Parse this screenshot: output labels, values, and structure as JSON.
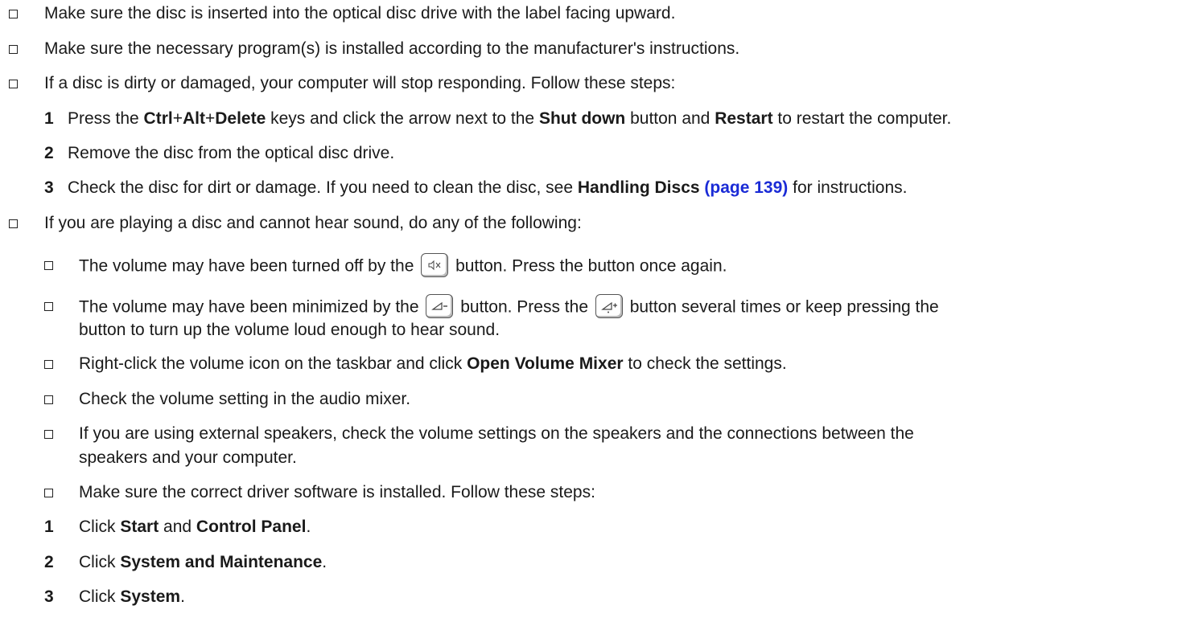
{
  "items": {
    "l1": "Make sure the disc is inserted into the optical disc drive with the label facing upward.",
    "l2": "Make sure the necessary program(s) is installed according to the manufacturer's instructions.",
    "l3": "If a disc is dirty or damaged, your computer will stop responding. Follow these steps:",
    "s1": {
      "num": "1",
      "t1": "Press the ",
      "k1": "Ctrl",
      "plus1": "+",
      "k2": "Alt",
      "plus2": "+",
      "k3": "Delete",
      "t2": " keys and click the arrow next to the ",
      "k4": "Shut down",
      "t3": " button and ",
      "k5": "Restart",
      "t4": " to restart the computer."
    },
    "s2": {
      "num": "2",
      "text": "Remove the disc from the optical disc drive."
    },
    "s3": {
      "num": "3",
      "t1": "Check the disc for dirt or damage. If you need to clean the disc, see ",
      "bold": "Handling Discs",
      "link": "(page 139)",
      "t2": " for instructions."
    },
    "l4": "If you are playing a disc and cannot hear sound, do any of the following:",
    "sub1": {
      "t1": "The volume may have been turned off by the",
      "t2": "button. Press the button once again."
    },
    "sub2": {
      "t1": "The volume may have been minimized by the",
      "t2": "button. Press the",
      "t3": "button several times or keep pressing the",
      "t4": "button to turn up the volume loud enough to hear sound."
    },
    "sub3": {
      "t1": "Right-click the volume icon on the taskbar and click ",
      "bold": "Open Volume Mixer",
      "t2": " to check the settings."
    },
    "sub4": "Check the volume setting in the audio mixer.",
    "sub5": {
      "t1": "If you are using external speakers, check the volume settings on the speakers and the connections between the",
      "t2": "speakers and your computer."
    },
    "sub6": "Make sure the correct driver software is installed. Follow these steps:",
    "d1": {
      "num": "1",
      "t1": "Click ",
      "b1": "Start",
      "t2": " and ",
      "b2": "Control Panel",
      "t3": "."
    },
    "d2": {
      "num": "2",
      "t1": "Click ",
      "b1": "System and Maintenance",
      "t2": "."
    },
    "d3": {
      "num": "3",
      "t1": "Click ",
      "b1": "System",
      "t2": "."
    }
  },
  "icons": {
    "mute": "mute-key-icon",
    "voldown": "volume-down-key-icon",
    "volup": "volume-up-key-icon"
  },
  "colors": {
    "link": "#1a2bd6",
    "text": "#1a1a1a"
  }
}
